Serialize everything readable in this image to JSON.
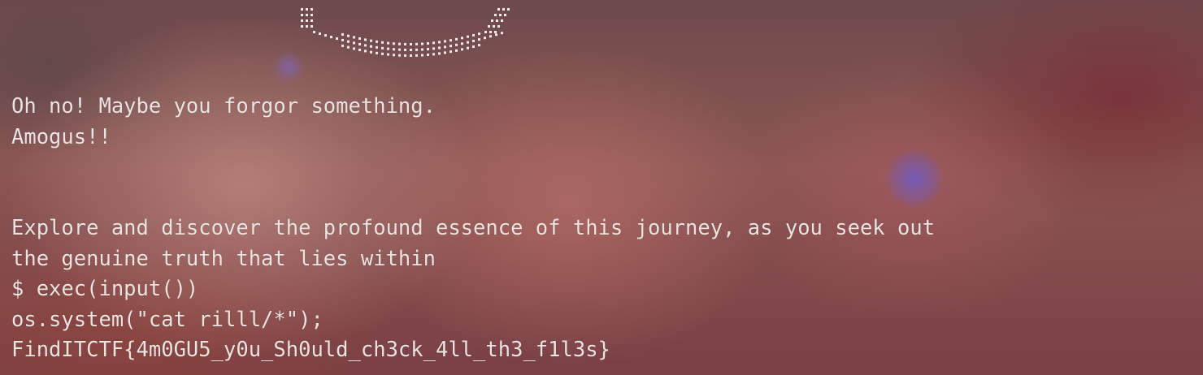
{
  "terminal": {
    "lines": [
      "Oh no! Maybe you forgor something.",
      "Amogus!!",
      "",
      "",
      "Explore and discover the profound essence of this journey, as you seek out",
      "the genuine truth that lies within",
      "$ exec(input())",
      "os.system(\"cat rilll/*\");",
      "FindITCTF{4m0GU5_y0u_Sh0uld_ch3ck_4ll_th3_f1l3s}"
    ]
  }
}
